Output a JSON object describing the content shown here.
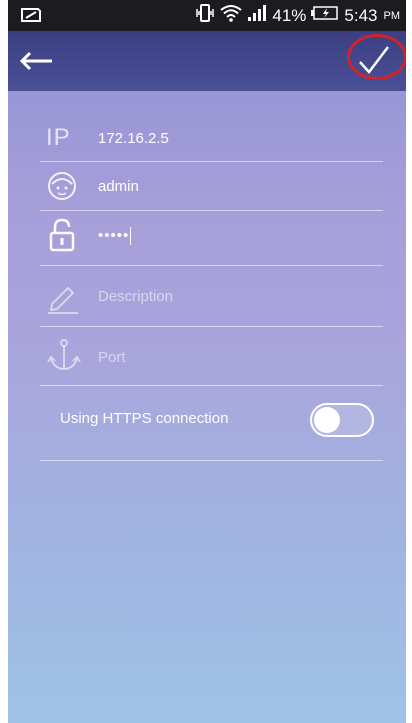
{
  "status_bar": {
    "battery_percent": "41%",
    "time": "5:43",
    "ampm": "PM"
  },
  "app_bar": {
    "back_icon": "arrow-left-icon",
    "confirm_icon": "checkmark-icon"
  },
  "form": {
    "ip": {
      "icon_text": "IP",
      "value": "172.16.2.5"
    },
    "username": {
      "icon": "user-face-icon",
      "value": "admin"
    },
    "password": {
      "icon": "lock-icon",
      "value": "•••••"
    },
    "description": {
      "icon": "pencil-icon",
      "placeholder": "Description"
    },
    "port": {
      "icon": "anchor-icon",
      "placeholder": "Port"
    },
    "https": {
      "label": "Using HTTPS connection",
      "enabled": false
    }
  },
  "colors": {
    "status_bar": "#1c1c20",
    "app_bar": "#3b3f82",
    "highlight": "#d0242a",
    "text": "#ffffff"
  }
}
